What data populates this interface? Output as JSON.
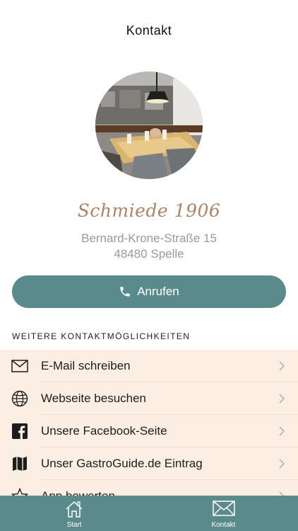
{
  "header": {
    "title": "Kontakt"
  },
  "restaurant": {
    "name": "Schmiede 1906",
    "address_line1": "Bernard-Krone-Straße 15",
    "address_line2": "48480 Spelle"
  },
  "call_button": {
    "label": "Anrufen",
    "icon": "phone-icon"
  },
  "section": {
    "title": "WEITERE KONTAKTMÖGLICHKEITEN"
  },
  "contact_options": [
    {
      "label": "E-Mail schreiben",
      "icon": "mail-icon"
    },
    {
      "label": "Webseite besuchen",
      "icon": "globe-icon"
    },
    {
      "label": "Unsere Facebook-Seite",
      "icon": "facebook-icon"
    },
    {
      "label": "Unser GastroGuide.de Eintrag",
      "icon": "map-icon"
    },
    {
      "label": "App bewerten",
      "icon": "star-icon"
    }
  ],
  "tabbar": {
    "tabs": [
      {
        "label": "Start",
        "icon": "home-icon"
      },
      {
        "label": "Kontakt",
        "icon": "envelope-icon"
      }
    ]
  },
  "colors": {
    "accent": "#5a8a8c",
    "list_background": "#fdeee4",
    "brand_text": "#a98468"
  }
}
